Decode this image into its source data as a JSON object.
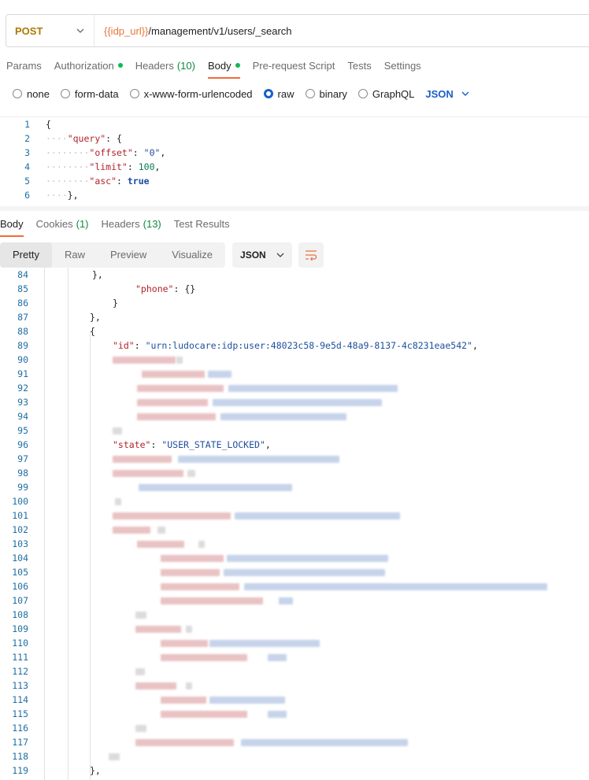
{
  "request": {
    "method": "POST",
    "url_var": "{{idp_url}}",
    "url_path": "/management/v1/users/_search"
  },
  "request_tabs": [
    {
      "label": "Params",
      "count": "",
      "dot": false,
      "active": false
    },
    {
      "label": "Authorization",
      "count": "",
      "dot": true,
      "active": false
    },
    {
      "label": "Headers",
      "count": "(10)",
      "dot": false,
      "active": false
    },
    {
      "label": "Body",
      "count": "",
      "dot": true,
      "active": true
    },
    {
      "label": "Pre-request Script",
      "count": "",
      "dot": false,
      "active": false
    },
    {
      "label": "Tests",
      "count": "",
      "dot": false,
      "active": false
    },
    {
      "label": "Settings",
      "count": "",
      "dot": false,
      "active": false
    }
  ],
  "body_types": [
    {
      "label": "none",
      "checked": false
    },
    {
      "label": "form-data",
      "checked": false
    },
    {
      "label": "x-www-form-urlencoded",
      "checked": false
    },
    {
      "label": "raw",
      "checked": true
    },
    {
      "label": "binary",
      "checked": false
    },
    {
      "label": "GraphQL",
      "checked": false
    }
  ],
  "body_language": "JSON",
  "request_body_lines": [
    {
      "n": "1",
      "text": "{"
    },
    {
      "n": "2",
      "text": "\"query\": {"
    },
    {
      "n": "3",
      "text": "\"offset\": \"0\","
    },
    {
      "n": "4",
      "text": "\"limit\": 100,"
    },
    {
      "n": "5",
      "text": "\"asc\": true"
    },
    {
      "n": "6",
      "text": "},"
    }
  ],
  "response_tabs": [
    {
      "label": "Body",
      "count": "",
      "active": true
    },
    {
      "label": "Cookies",
      "count": "(1)",
      "active": false
    },
    {
      "label": "Headers",
      "count": "(13)",
      "active": false
    },
    {
      "label": "Test Results",
      "count": "",
      "active": false
    }
  ],
  "view_modes": [
    {
      "label": "Pretty",
      "active": true
    },
    {
      "label": "Raw",
      "active": false
    },
    {
      "label": "Preview",
      "active": false
    },
    {
      "label": "Visualize",
      "active": false
    }
  ],
  "response_format": "JSON",
  "response_lines": {
    "l84": {
      "n": "84",
      "text": "},"
    },
    "l85": {
      "n": "85",
      "key": "\"phone\"",
      "rest": ": {}"
    },
    "l86": {
      "n": "86",
      "text": "}"
    },
    "l87": {
      "n": "87",
      "text": "},"
    },
    "l88": {
      "n": "88",
      "text": "{"
    },
    "l89": {
      "n": "89",
      "key": "\"id\"",
      "value": "\"urn:ludocare:idp:user:48023c58-9e5d-48a9-8137-4c8231eae542\""
    },
    "l96": {
      "n": "96",
      "key": "\"state\"",
      "value": "\"USER_STATE_LOCKED\""
    },
    "l119": {
      "n": "119",
      "text": "},"
    },
    "redacted_numbers": [
      "90",
      "91",
      "92",
      "93",
      "94",
      "95",
      "97",
      "98",
      "99",
      "100",
      "101",
      "102",
      "103",
      "104",
      "105",
      "106",
      "107",
      "108",
      "109",
      "110",
      "111",
      "112",
      "113",
      "114",
      "115",
      "116",
      "117",
      "118"
    ]
  }
}
